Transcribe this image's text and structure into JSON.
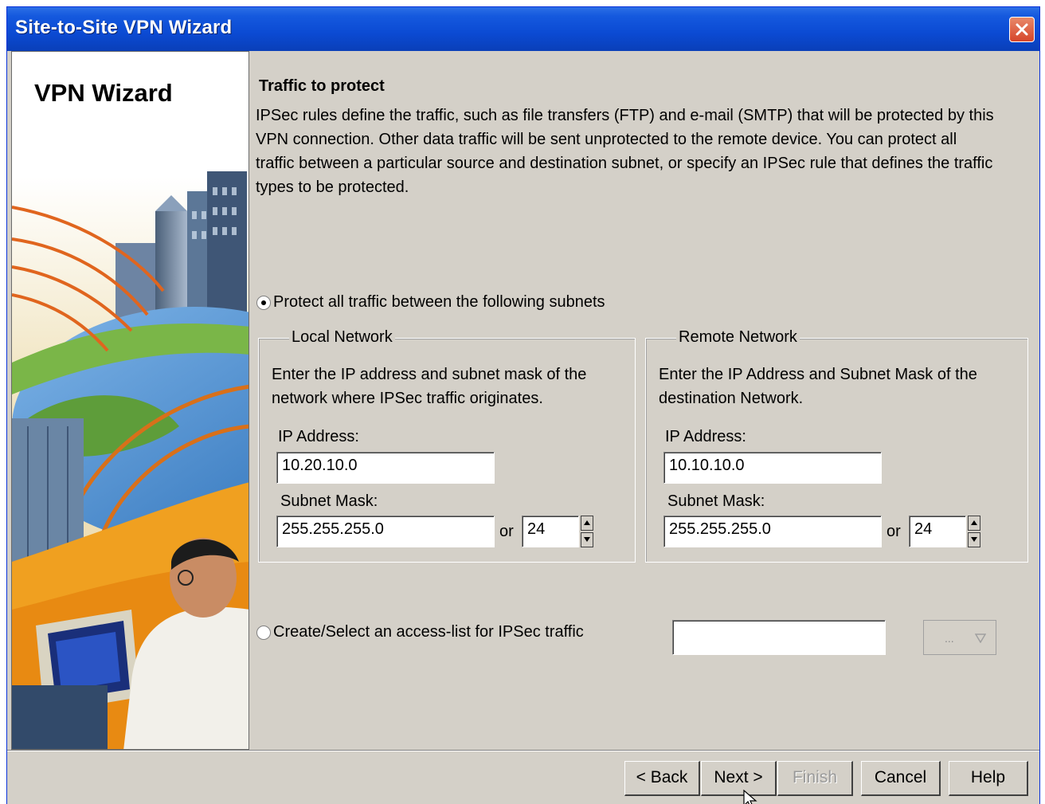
{
  "window": {
    "title": "Site-to-Site VPN Wizard"
  },
  "sidebar": {
    "title": "VPN Wizard"
  },
  "content": {
    "heading": "Traffic to protect",
    "description": "IPSec rules define the traffic, such as file transfers (FTP) and e-mail (SMTP) that will be protected by this VPN connection. Other data traffic will be sent unprotected to the remote device. You can protect all traffic between a particular source and destination subnet, or specify an IPSec rule that defines the traffic types to be protected.",
    "option_subnets": {
      "label": "Protect all traffic between the following subnets",
      "selected": true
    },
    "local": {
      "legend": "Local Network",
      "help": "Enter the IP address and subnet mask of the network where IPSec traffic originates.",
      "ip_label": "IP Address:",
      "ip_value": "10.20.10.0",
      "mask_label": "Subnet Mask:",
      "mask_value": "255.255.255.0",
      "or_label": "or",
      "prefix_value": "24"
    },
    "remote": {
      "legend": "Remote Network",
      "help": "Enter the IP Address and Subnet Mask of the destination Network.",
      "ip_label": "IP Address:",
      "ip_value": "10.10.10.0",
      "mask_label": "Subnet Mask:",
      "mask_value": "255.255.255.0",
      "or_label": "or",
      "prefix_value": "24"
    },
    "option_acl": {
      "label": "Create/Select an access-list for IPSec traffic",
      "selected": false,
      "value": "",
      "button_label": "..."
    }
  },
  "buttons": {
    "back": "< Back",
    "next": "Next >",
    "finish": "Finish",
    "cancel": "Cancel",
    "help": "Help"
  },
  "colors": {
    "titlebar": "#0b4ad3",
    "dialog": "#d4d0c8",
    "close": "#d6452a"
  }
}
